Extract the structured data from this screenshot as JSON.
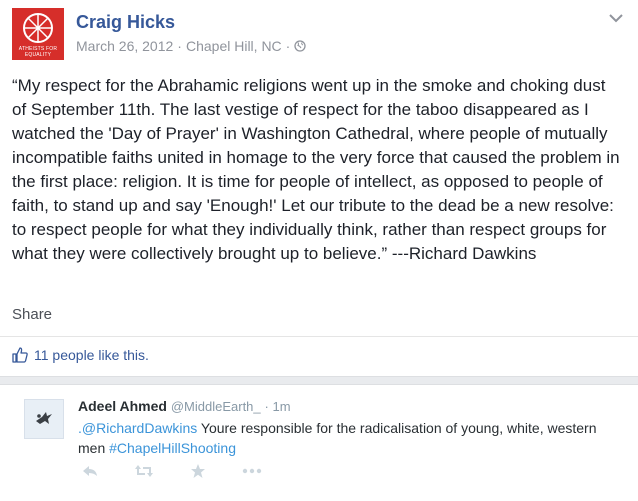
{
  "post": {
    "author_name": "Craig Hicks",
    "date": "March 26, 2012",
    "separator": "·",
    "location": "Chapel Hill, NC",
    "avatar_text_line1": "ATHEISTS FOR",
    "avatar_text_line2": "EQUALITY",
    "text": "“My respect for the Abrahamic religions went up in the smoke and choking dust of September 11th. The last vestige of respect for the taboo disappeared as I watched the 'Day of Prayer' in Washington Cathedral, where people of mutually incompatible faiths united in homage to the very force that caused the problem in the first place: religion. It is time for people of intellect, as opposed to people of faith, to stand up and say 'Enough!' Let our tribute to the dead be a new resolve: to respect people for what they individually think, rather than respect groups for what they were collectively brought up to believe.” ---Richard Dawkins",
    "share_label": "Share",
    "likes_text": "11 people like this."
  },
  "tweet": {
    "name": "Adeel Ahmed",
    "handle": "@MiddleEarth_",
    "time": "· 1m",
    "mention": ".@RichardDawkins",
    "text_part1": " Youre  responsible for the radicalisation of young, white, western men ",
    "hashtag": "#ChapelHillShooting"
  },
  "colors": {
    "facebook_link": "#365899",
    "avatar_red": "#d62e2a",
    "twitter_link": "#3b94d9",
    "muted_gray": "#90949c"
  },
  "icons": [
    "globe-icon",
    "chevron-down-icon",
    "thumbs-up-icon",
    "reply-icon",
    "retweet-icon",
    "favorite-star-icon",
    "more-options-icon"
  ]
}
